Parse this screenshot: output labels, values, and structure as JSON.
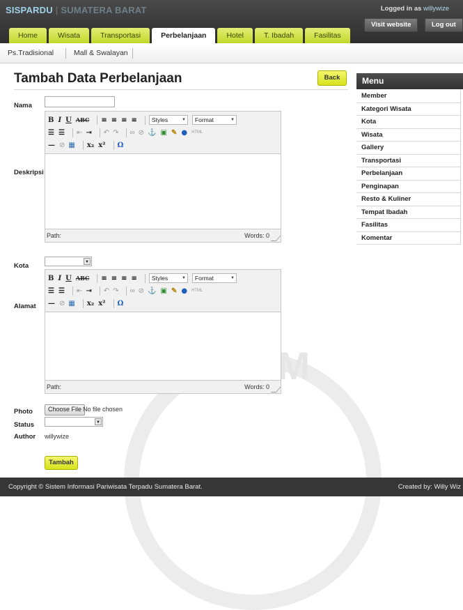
{
  "header": {
    "brand_main": "SISPARDU",
    "brand_sep": "|",
    "brand_sub": "SUMATERA BARAT",
    "logged_in_prefix": "Logged in as",
    "logged_in_user": "willywize",
    "visit_website": "Visit website",
    "logout": "Log out"
  },
  "tabs": [
    {
      "label": "Home"
    },
    {
      "label": "Wisata"
    },
    {
      "label": "Transportasi"
    },
    {
      "label": "Perbelanjaan",
      "active": true
    },
    {
      "label": "Hotel"
    },
    {
      "label": "T. Ibadah"
    },
    {
      "label": "Fasilitas"
    }
  ],
  "subnav": [
    {
      "label": "Ps.Tradisional"
    },
    {
      "label": "Mall & Swalayan"
    }
  ],
  "main": {
    "title": "Tambah Data Perbelanjaan",
    "back": "Back"
  },
  "form": {
    "nama_label": "Nama",
    "nama_value": "",
    "deskripsi_label": "Deskripsi",
    "kota_label": "Kota",
    "kota_value": "",
    "alamat_label": "Alamat",
    "photo_label": "Photo",
    "choose_file": "Choose File",
    "no_file": "No file chosen",
    "status_label": "Status",
    "status_value": "",
    "author_label": "Author",
    "author_value": "willywize",
    "submit": "Tambah"
  },
  "editor": {
    "styles": "Styles",
    "format": "Format",
    "path_label": "Path:",
    "words_label": "Words: 0"
  },
  "sidebar": {
    "title": "Menu",
    "items": [
      {
        "label": "Member"
      },
      {
        "label": "Kategori Wisata"
      },
      {
        "label": "Kota"
      },
      {
        "label": "Wisata"
      },
      {
        "label": "Gallery"
      },
      {
        "label": "Transportasi"
      },
      {
        "label": "Perbelanjaan"
      },
      {
        "label": "Penginapan"
      },
      {
        "label": "Resto & Kuliner"
      },
      {
        "label": "Tempat Ibadah"
      },
      {
        "label": "Fasilitas"
      },
      {
        "label": "Komentar"
      }
    ]
  },
  "watermark": "ISLAM",
  "footer": {
    "copyright": "Copyright © Sistem Informasi Pariwisata Terpadu Sumatera Barat.",
    "created": "Created by: Willy Wiz"
  },
  "colors": {
    "accent_yellow": "#c2d72b",
    "header_dark": "#3a3a3a",
    "footer_dark": "#363636"
  }
}
